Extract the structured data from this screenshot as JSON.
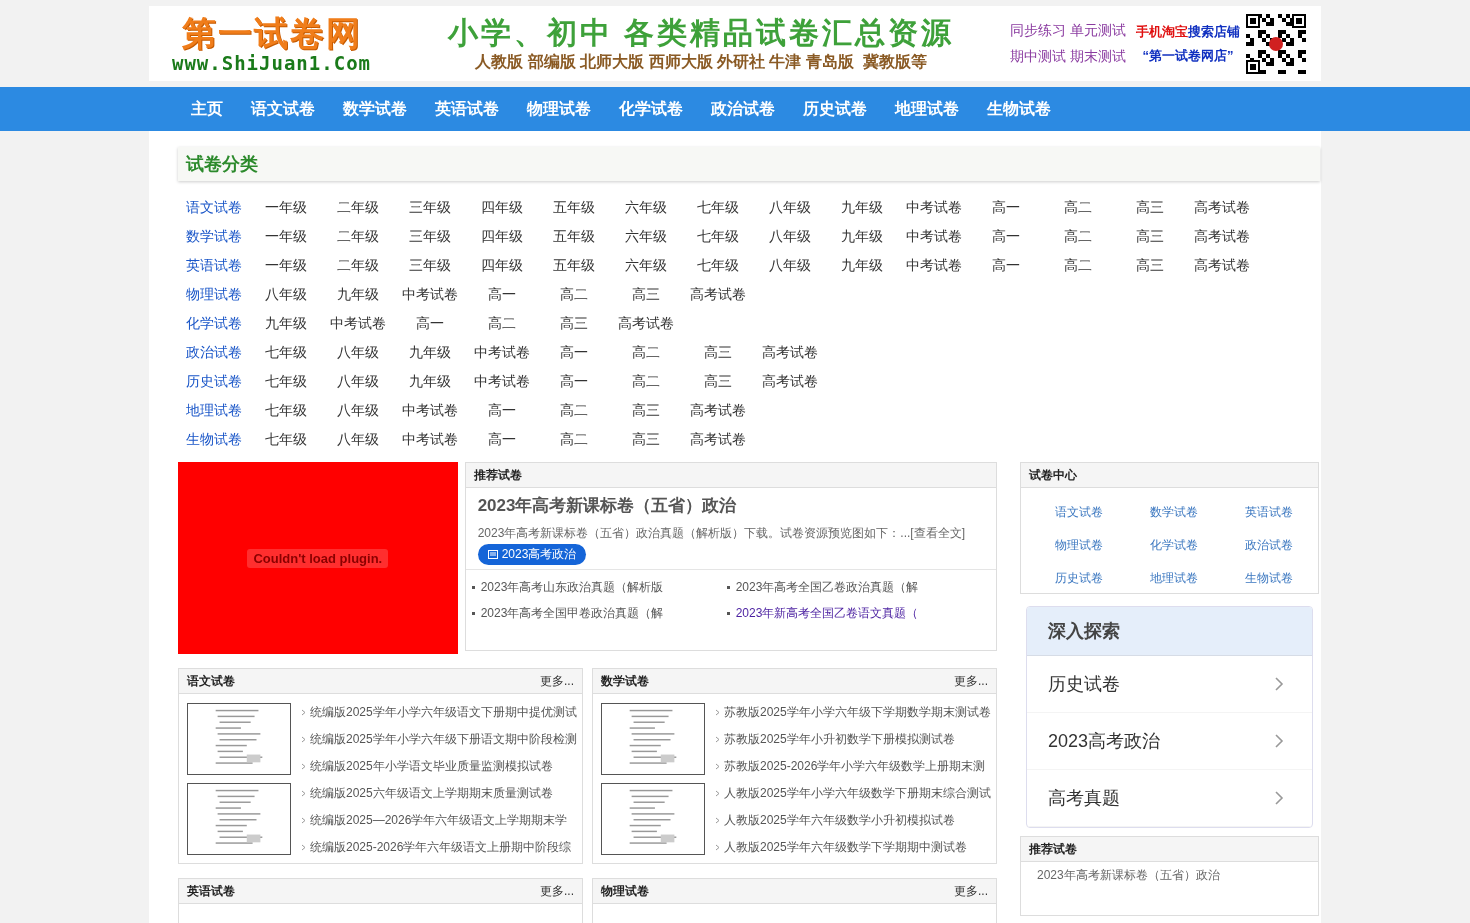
{
  "header": {
    "logo_title": "第一试卷网",
    "logo_url": "www.ShiJuan1.Com",
    "slogan": "小学、初中 各类精品试卷汇总资源",
    "editions": "人教版 部编版 北师大版 西师大版 外研社 牛津 青岛版  冀教版等",
    "tests": [
      "同步练习 单元测试",
      "期中测试 期末测试"
    ],
    "shop_search": "手机淘宝",
    "shop_search_2": "搜索店铺",
    "shop_name": "“第一试卷网店”"
  },
  "nav": [
    "主页",
    "语文试卷",
    "数学试卷",
    "英语试卷",
    "物理试卷",
    "化学试卷",
    "政治试卷",
    "历史试卷",
    "地理试卷",
    "生物试卷"
  ],
  "category": {
    "title": "试卷分类",
    "rows": [
      {
        "subject": "语文试卷",
        "grades": [
          "一年级",
          "二年级",
          "三年级",
          "四年级",
          "五年级",
          "六年级",
          "七年级",
          "八年级",
          "九年级",
          "中考试卷",
          "高一",
          "高二",
          "高三",
          "高考试卷"
        ]
      },
      {
        "subject": "数学试卷",
        "grades": [
          "一年级",
          "二年级",
          "三年级",
          "四年级",
          "五年级",
          "六年级",
          "七年级",
          "八年级",
          "九年级",
          "中考试卷",
          "高一",
          "高二",
          "高三",
          "高考试卷"
        ]
      },
      {
        "subject": "英语试卷",
        "grades": [
          "一年级",
          "二年级",
          "三年级",
          "四年级",
          "五年级",
          "六年级",
          "七年级",
          "八年级",
          "九年级",
          "中考试卷",
          "高一",
          "高二",
          "高三",
          "高考试卷"
        ]
      },
      {
        "subject": "物理试卷",
        "grades": [
          "八年级",
          "九年级",
          "中考试卷",
          "高一",
          "高二",
          "高三",
          "高考试卷"
        ]
      },
      {
        "subject": "化学试卷",
        "grades": [
          "九年级",
          "中考试卷",
          "高一",
          "高二",
          "高三",
          "高考试卷"
        ]
      },
      {
        "subject": "政治试卷",
        "grades": [
          "七年级",
          "八年级",
          "九年级",
          "中考试卷",
          "高一",
          "高二",
          "高三",
          "高考试卷"
        ]
      },
      {
        "subject": "历史试卷",
        "grades": [
          "七年级",
          "八年级",
          "九年级",
          "中考试卷",
          "高一",
          "高二",
          "高三",
          "高考试卷"
        ]
      },
      {
        "subject": "地理试卷",
        "grades": [
          "七年级",
          "八年级",
          "中考试卷",
          "高一",
          "高二",
          "高三",
          "高考试卷"
        ]
      },
      {
        "subject": "生物试卷",
        "grades": [
          "七年级",
          "八年级",
          "中考试卷",
          "高一",
          "高二",
          "高三",
          "高考试卷"
        ]
      }
    ]
  },
  "plugin": {
    "message": "Couldn't load plugin."
  },
  "featured": {
    "header": "推荐试卷",
    "title": "2023年高考新课标卷（五省）政治",
    "summary": "2023年高考新课标卷（五省）政治真题（解析版）下载。试卷资源预览图如下：...[查看全文]",
    "tag": "2023高考政治",
    "links": [
      {
        "text": "2023年高考山东政治真题（解析版",
        "visited": false
      },
      {
        "text": "2023年高考全国乙卷政治真题（解",
        "visited": false
      },
      {
        "text": "2023年高考全国甲卷政治真题（解",
        "visited": false
      },
      {
        "text": "2023年新高考全国乙卷语文真题（",
        "visited": true
      }
    ]
  },
  "panels": [
    {
      "title": "语文试卷",
      "more": "更多...",
      "items": [
        "统编版2025学年小学六年级语文下册期中提优测试",
        "统编版2025学年小学六年级下册语文期中阶段检测",
        "统编版2025年小学语文毕业质量监测模拟试卷",
        "统编版2025六年级语文上学期期末质量测试卷",
        "统编版2025—2026学年六年级语文上学期期末学",
        "统编版2025-2026学年六年级语文上册期中阶段综"
      ]
    },
    {
      "title": "数学试卷",
      "more": "更多...",
      "items": [
        "苏教版2025学年小学六年级下学期数学期末测试卷",
        "苏教版2025学年小升初数学下册模拟测试卷",
        "苏教版2025-2026学年小学六年级数学上册期末测",
        "人教版2025学年小学六年级数学下册期末综合测试",
        "人教版2025学年六年级数学小升初模拟试卷",
        "人教版2025学年六年级数学下学期期中测试卷"
      ]
    },
    {
      "title": "英语试卷",
      "more": "更多..."
    },
    {
      "title": "物理试卷",
      "more": "更多..."
    }
  ],
  "exam_center": {
    "title": "试卷中心",
    "links": [
      "语文试卷",
      "数学试卷",
      "英语试卷",
      "物理试卷",
      "化学试卷",
      "政治试卷",
      "历史试卷",
      "地理试卷",
      "生物试卷"
    ]
  },
  "explore": {
    "title": "深入探索",
    "items": [
      "历史试卷",
      "2023高考政治",
      "高考真题"
    ]
  },
  "side_recommend": {
    "title": "推荐试卷",
    "items": [
      "2023年高考新课标卷（五省）政治"
    ]
  }
}
